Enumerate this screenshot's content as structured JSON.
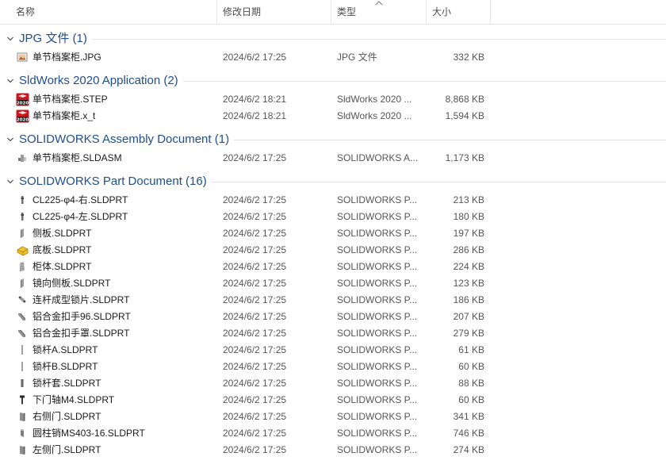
{
  "columns": {
    "name": "名称",
    "date": "修改日期",
    "type": "类型",
    "size": "大小"
  },
  "groups": [
    {
      "title": "JPG 文件 (1)",
      "files": [
        {
          "name": "单节档案柜.JPG",
          "date": "2024/6/2 17:25",
          "type": "JPG 文件",
          "size": "332 KB",
          "icon": "jpg-image-icon"
        }
      ]
    },
    {
      "title": "SldWorks 2020 Application (2)",
      "files": [
        {
          "name": "单节档案柜.STEP",
          "date": "2024/6/2 18:21",
          "type": "SldWorks 2020 ...",
          "size": "8,868 KB",
          "icon": "solidworks-2020-icon"
        },
        {
          "name": "单节档案柜.x_t",
          "date": "2024/6/2 18:21",
          "type": "SldWorks 2020 ...",
          "size": "1,594 KB",
          "icon": "solidworks-2020-icon"
        }
      ]
    },
    {
      "title": "SOLIDWORKS Assembly Document (1)",
      "files": [
        {
          "name": "单节档案柜.SLDASM",
          "date": "2024/6/2 17:25",
          "type": "SOLIDWORKS A...",
          "size": "1,173 KB",
          "icon": "assembly-icon"
        }
      ]
    },
    {
      "title": "SOLIDWORKS Part Document (16)",
      "files": [
        {
          "name": "CL225-φ4-右.SLDPRT",
          "date": "2024/6/2 17:25",
          "type": "SOLIDWORKS P...",
          "size": "213 KB",
          "icon": "hinge-part-icon"
        },
        {
          "name": "CL225-φ4-左.SLDPRT",
          "date": "2024/6/2 17:25",
          "type": "SOLIDWORKS P...",
          "size": "180 KB",
          "icon": "hinge-part-icon"
        },
        {
          "name": "侧板.SLDPRT",
          "date": "2024/6/2 17:25",
          "type": "SOLIDWORKS P...",
          "size": "197 KB",
          "icon": "panel-part-icon"
        },
        {
          "name": "底板.SLDPRT",
          "date": "2024/6/2 17:25",
          "type": "SOLIDWORKS P...",
          "size": "286 KB",
          "icon": "yellow-part-icon"
        },
        {
          "name": "柜体.SLDPRT",
          "date": "2024/6/2 17:25",
          "type": "SOLIDWORKS P...",
          "size": "224 KB",
          "icon": "cabinet-part-icon"
        },
        {
          "name": "镜向侧板.SLDPRT",
          "date": "2024/6/2 17:25",
          "type": "SOLIDWORKS P...",
          "size": "123 KB",
          "icon": "panel-part-icon"
        },
        {
          "name": "连杆成型锁片.SLDPRT",
          "date": "2024/6/2 17:25",
          "type": "SOLIDWORKS P...",
          "size": "186 KB",
          "icon": "link-part-icon"
        },
        {
          "name": "铝合金扣手96.SLDPRT",
          "date": "2024/6/2 17:25",
          "type": "SOLIDWORKS P...",
          "size": "207 KB",
          "icon": "handle-part-icon"
        },
        {
          "name": "铝合金扣手罩.SLDPRT",
          "date": "2024/6/2 17:25",
          "type": "SOLIDWORKS P...",
          "size": "279 KB",
          "icon": "handle-part-icon"
        },
        {
          "name": "锁杆A.SLDPRT",
          "date": "2024/6/2 17:25",
          "type": "SOLIDWORKS P...",
          "size": "61 KB",
          "icon": "rod-part-icon"
        },
        {
          "name": "锁杆B.SLDPRT",
          "date": "2024/6/2 17:25",
          "type": "SOLIDWORKS P...",
          "size": "60 KB",
          "icon": "rod-part-icon"
        },
        {
          "name": "锁杆套.SLDPRT",
          "date": "2024/6/2 17:25",
          "type": "SOLIDWORKS P...",
          "size": "88 KB",
          "icon": "sleeve-part-icon"
        },
        {
          "name": "下门轴M4.SLDPRT",
          "date": "2024/6/2 17:25",
          "type": "SOLIDWORKS P...",
          "size": "60 KB",
          "icon": "pin-part-icon"
        },
        {
          "name": "右侧门.SLDPRT",
          "date": "2024/6/2 17:25",
          "type": "SOLIDWORKS P...",
          "size": "341 KB",
          "icon": "door-part-icon"
        },
        {
          "name": "圆柱销MS403-16.SLDPRT",
          "date": "2024/6/2 17:25",
          "type": "SOLIDWORKS P...",
          "size": "746 KB",
          "icon": "cylinder-pin-part-icon"
        },
        {
          "name": "左侧门.SLDPRT",
          "date": "2024/6/2 17:25",
          "type": "SOLIDWORKS P...",
          "size": "274 KB",
          "icon": "door-part-icon"
        }
      ]
    }
  ]
}
